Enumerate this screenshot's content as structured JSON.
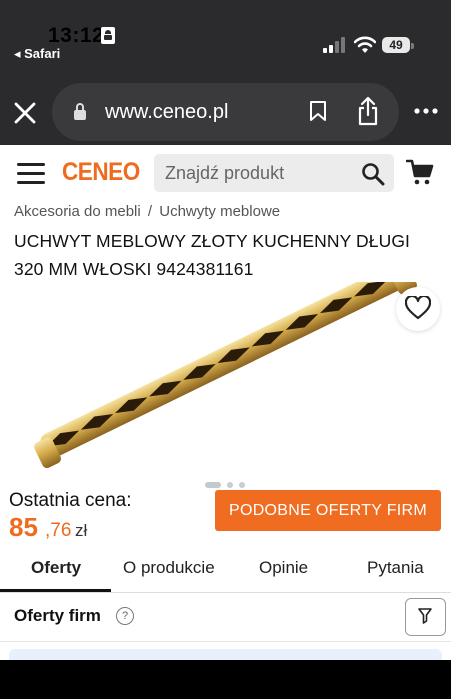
{
  "status_bar": {
    "time": "13:12",
    "back_app": "◂ Safari",
    "battery": "49"
  },
  "browser": {
    "url": "www.ceneo.pl"
  },
  "header": {
    "logo": "CENEO",
    "search_placeholder": "Znajdź produkt"
  },
  "breadcrumb": {
    "items": [
      "Akcesoria do mebli",
      "Uchwyty meblowe"
    ],
    "separator": "/"
  },
  "product": {
    "title_line1": "UCHWYT MEBLOWY ZŁOTY KUCHENNY DŁUGI",
    "title_line2": "320 MM WŁOSKI 9424381161",
    "image_alt": "gold-cabinet-handle",
    "gallery_total": 3,
    "gallery_active": 1
  },
  "price": {
    "label": "Ostatnia cena:",
    "main": "85",
    "cents": ",76",
    "currency": "zł"
  },
  "cta": {
    "similar_offers": "PODOBNE OFERTY FIRM"
  },
  "tabs": [
    {
      "label": "Oferty",
      "active": true
    },
    {
      "label": "O produkcie",
      "active": false
    },
    {
      "label": "Opinie",
      "active": false
    },
    {
      "label": "Pytania",
      "active": false
    }
  ],
  "offers": {
    "title": "Oferty firm",
    "help": "?"
  },
  "colors": {
    "brand_orange": "#ee6b1f",
    "safari_dark": "#2b2b2d",
    "light_blue": "#e8effd"
  }
}
